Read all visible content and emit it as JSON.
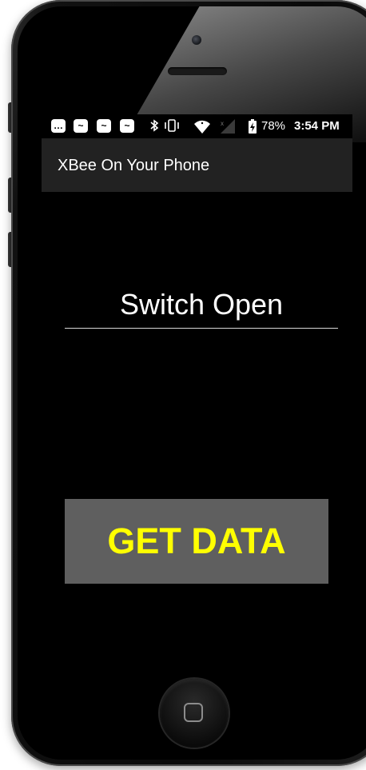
{
  "status_bar": {
    "battery": "78%",
    "time": "3:54 PM",
    "icons": [
      "message-icon",
      "app-notification-icon",
      "app-notification-icon",
      "app-notification-icon",
      "bluetooth-icon",
      "vibrate-icon",
      "wifi-icon",
      "signal-icon",
      "battery-charging-icon"
    ]
  },
  "app_bar": {
    "title": "XBee On Your Phone"
  },
  "main": {
    "status_value": "Switch Open",
    "get_data_label": "GET DATA"
  },
  "colors": {
    "button_background": "#5f5f5f",
    "button_text": "#ffff00",
    "app_bar_background": "#222222",
    "screen_background": "#000000"
  }
}
